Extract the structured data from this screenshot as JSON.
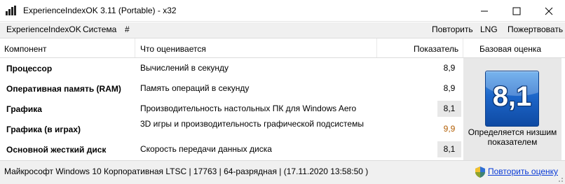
{
  "window": {
    "title": "ExperienceIndexOK 3.11 (Portable) - x32"
  },
  "menu": {
    "left": [
      {
        "label": "ExperienceIndexOK"
      },
      {
        "label": "Система"
      },
      {
        "label": "#"
      }
    ],
    "right": [
      {
        "label": "Повторить"
      },
      {
        "label": "LNG"
      },
      {
        "label": "Пожертвовать"
      }
    ]
  },
  "table": {
    "headers": {
      "component": "Компонент",
      "what": "Что оценивается",
      "score": "Показатель",
      "base": "Базовая оценка"
    },
    "rows": [
      {
        "component": "Процессор",
        "what": "Вычислений в секунду",
        "score": "8,9"
      },
      {
        "component": "Оперативная память (RAM)",
        "what": "Память операций в секунду",
        "score": "8,9"
      },
      {
        "component": "Графика",
        "what": "Производительность настольных ПК для Windows Aero",
        "score": "8,1"
      },
      {
        "component": "Графика (в играх)",
        "what": "3D игры и производительность графической подсистемы",
        "score": "9,9"
      },
      {
        "component": "Основной жесткий диск",
        "what": "Скорость передачи данных диска",
        "score": "8,1"
      }
    ]
  },
  "base_score": {
    "value": "8,1",
    "caption": "Определяется низшим показателем"
  },
  "status": {
    "text": "Майкрософт Windows 10 Корпоративная LTSC | 17763 | 64-разрядная | (17.11.2020 13:58:50 )",
    "rerate_link": "Повторить оценку"
  },
  "colors": {
    "accent_orange": "#b15c00",
    "link_blue": "#0a3bd6",
    "tile_blue": "#1d66c9"
  }
}
